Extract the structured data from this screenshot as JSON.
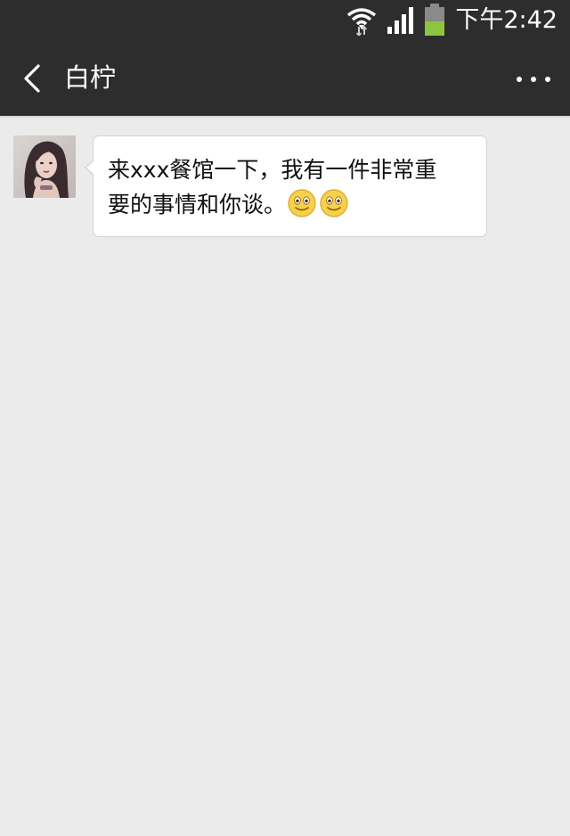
{
  "status_bar": {
    "time": "下午2:42",
    "icons": [
      "wifi-icon",
      "signal-icon",
      "battery-icon"
    ],
    "battery_color": "#8cc63f"
  },
  "header": {
    "title": "白柠",
    "back_icon": "chevron-left-icon",
    "more_icon": "more-dots-icon",
    "background": "#2c2d2c"
  },
  "chat": {
    "background": "#ebebeb",
    "messages": [
      {
        "sender": "incoming",
        "avatar_icon": "user-avatar",
        "line1": "来xxx餐馆一下，我有一件非常重",
        "line2": "要的事情和你谈。",
        "emojis": [
          "smile-emoji",
          "smile-emoji"
        ]
      }
    ]
  }
}
